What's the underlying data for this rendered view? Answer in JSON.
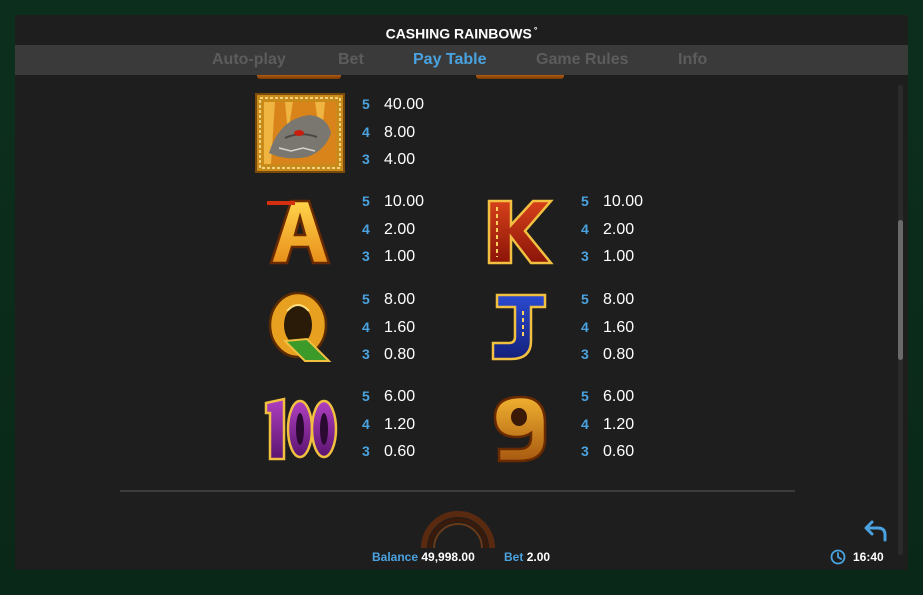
{
  "game": {
    "title": "CASHING RAINBOWS",
    "title_mark": "°"
  },
  "tabs": [
    {
      "label": "Auto-play",
      "active": false
    },
    {
      "label": "Bet",
      "active": false
    },
    {
      "label": "Pay Table",
      "active": true
    },
    {
      "label": "Game Rules",
      "active": false
    },
    {
      "label": "Info",
      "active": false
    }
  ],
  "paytable": {
    "dragon": {
      "icon": "dragon-symbol-icon",
      "rows": [
        {
          "count": "5",
          "value": "40.00"
        },
        {
          "count": "4",
          "value": "8.00"
        },
        {
          "count": "3",
          "value": "4.00"
        }
      ]
    },
    "ace": {
      "icon": "ace-symbol-icon",
      "rows": [
        {
          "count": "5",
          "value": "10.00"
        },
        {
          "count": "4",
          "value": "2.00"
        },
        {
          "count": "3",
          "value": "1.00"
        }
      ]
    },
    "king": {
      "icon": "king-symbol-icon",
      "rows": [
        {
          "count": "5",
          "value": "10.00"
        },
        {
          "count": "4",
          "value": "2.00"
        },
        {
          "count": "3",
          "value": "1.00"
        }
      ]
    },
    "queen": {
      "icon": "queen-symbol-icon",
      "rows": [
        {
          "count": "5",
          "value": "8.00"
        },
        {
          "count": "4",
          "value": "1.60"
        },
        {
          "count": "3",
          "value": "0.80"
        }
      ]
    },
    "jack": {
      "icon": "jack-symbol-icon",
      "rows": [
        {
          "count": "5",
          "value": "8.00"
        },
        {
          "count": "4",
          "value": "1.60"
        },
        {
          "count": "3",
          "value": "0.80"
        }
      ]
    },
    "ten": {
      "icon": "ten-symbol-icon",
      "rows": [
        {
          "count": "5",
          "value": "6.00"
        },
        {
          "count": "4",
          "value": "1.20"
        },
        {
          "count": "3",
          "value": "0.60"
        }
      ]
    },
    "nine": {
      "icon": "nine-symbol-icon",
      "rows": [
        {
          "count": "5",
          "value": "6.00"
        },
        {
          "count": "4",
          "value": "1.20"
        },
        {
          "count": "3",
          "value": "0.60"
        }
      ]
    }
  },
  "status": {
    "balance_label": "Balance",
    "balance_value": "49,998.00",
    "bet_label": "Bet",
    "bet_value": "2.00",
    "time": "16:40"
  },
  "colors": {
    "accent": "#4aa3e0",
    "background": "#1e1e1e",
    "frame": "#0b3a23",
    "gold": "#e8a521"
  }
}
